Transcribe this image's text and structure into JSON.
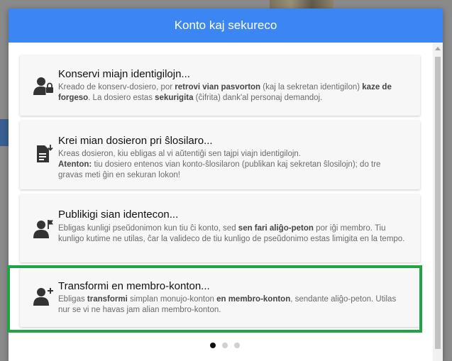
{
  "dialog": {
    "title": "Konto kaj sekureco"
  },
  "cards": [
    {
      "icon": "user-lock-icon",
      "title": "Konservi miajn identigilojn...",
      "desc": [
        [
          "Kreado de konserv-dosiero, por ",
          false
        ],
        [
          "retrovi vian pasvorton",
          true
        ],
        [
          " (kaj la sekretan identigilon) ",
          false
        ],
        [
          "kaze de forgeso",
          true
        ],
        [
          ". La dosiero estas ",
          false
        ],
        [
          "sekurigita",
          true
        ],
        [
          " (ĉifrita) dank'al personaj demandoj.",
          false
        ]
      ]
    },
    {
      "icon": "file-download-icon",
      "title": "Krei mian dosieron pri ŝlosilaro...",
      "desc": [
        [
          "Kreas dosieron, kiu ebligas al vi aŭtentiĝi sen tajpi viajn identigilojn.",
          false
        ],
        [
          "\n",
          false
        ],
        [
          "Atenton:",
          true
        ],
        [
          " tiu dosiero entenos vian konto-ŝlosilaron (publikan kaj sekretan ŝlosilojn); do tre gravas meti ĝin en sekuran lokon!",
          false
        ]
      ]
    },
    {
      "icon": "user-flag-icon",
      "title": "Publikigi sian identecon...",
      "desc": [
        [
          "Ebligas kunligi pseŭdonimon kun tiu ĉi konto, sed ",
          false
        ],
        [
          "sen fari aliĝo-peton",
          true
        ],
        [
          " por iĝi membro. Tiu kunligo kutime ne utilas, ĉar la valideco de tiu kunligo de pseŭdonimo estas limigita en la tempo.",
          false
        ]
      ]
    },
    {
      "icon": "user-plus-icon",
      "title": "Transformi en membro-konton...",
      "desc": [
        [
          "Ebligas ",
          false
        ],
        [
          "transformi",
          true
        ],
        [
          " simplan monujo-konton ",
          false
        ],
        [
          "en membro-konton",
          true
        ],
        [
          ", sendante aliĝo-peton. Utilas nur se vi ne havas jam alian membro-konton.",
          false
        ]
      ]
    }
  ],
  "pager": {
    "count": 3,
    "active_index": 0
  },
  "colors": {
    "header": "#3b86f2",
    "highlight": "#1fa546"
  }
}
